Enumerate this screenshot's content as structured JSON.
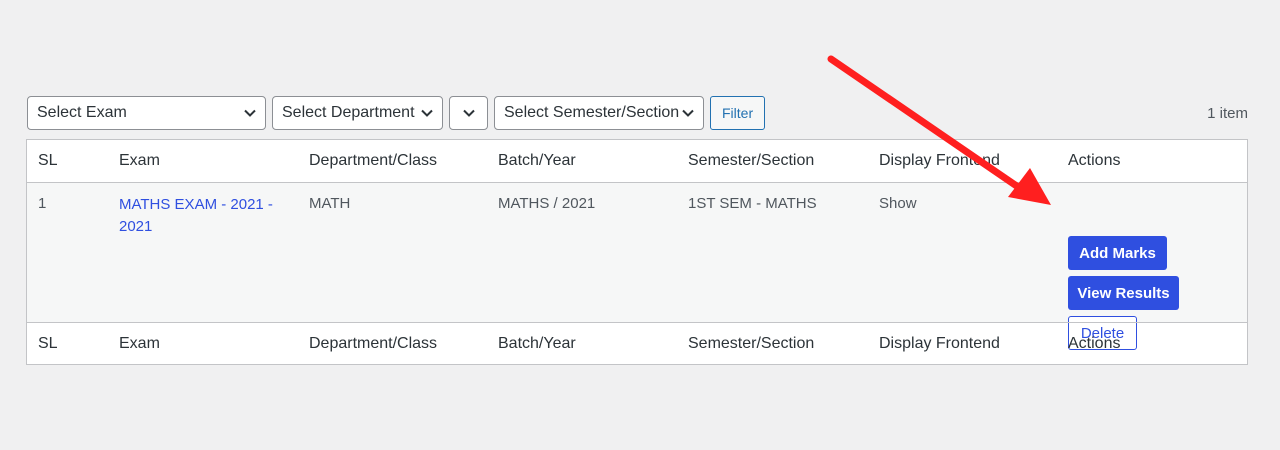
{
  "filters": {
    "exam_select": "Select Exam",
    "department_select": "Select Department",
    "batch_select": "",
    "semester_select": "Select Semester/Section",
    "filter_button": "Filter"
  },
  "item_count": "1 item",
  "table": {
    "columns": [
      "SL",
      "Exam",
      "Department/Class",
      "Batch/Year",
      "Semester/Section",
      "Display Frontend",
      "Actions"
    ],
    "rows": [
      {
        "sl": "1",
        "exam": "MATHS EXAM - 2021 - 2021",
        "department": "MATH",
        "batch": "MATHS / 2021",
        "semester": "1ST SEM - MATHS",
        "display": "Show",
        "actions": {
          "add_marks": "Add Marks",
          "view_results": "View Results",
          "delete": "Delete"
        }
      }
    ]
  },
  "colors": {
    "primary": "#2f4fe0",
    "annotation_arrow": "#ff1f1f"
  },
  "icons": {
    "dropdown": "chevron-down-icon",
    "annotation": "red-arrow-icon"
  }
}
